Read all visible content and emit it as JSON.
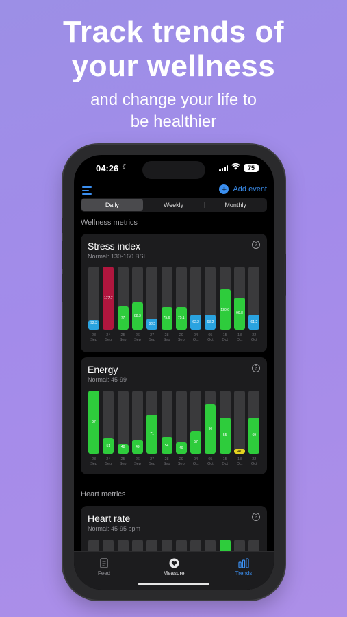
{
  "promo": {
    "headline_line1": "Track trends of",
    "headline_line2": "your wellness",
    "subline_line1": "and change your life to",
    "subline_line2": "be healthier"
  },
  "status_bar": {
    "time": "04:26",
    "battery": "75"
  },
  "topbar": {
    "menu_icon": "menu-icon",
    "add_event_label": "Add event"
  },
  "tabs_period": [
    "Daily",
    "Weekly",
    "Monthly"
  ],
  "selected_period": "Daily",
  "sections": {
    "wellness": "Wellness metrics",
    "heart": "Heart metrics"
  },
  "colors": {
    "green": "#2ecc3c",
    "red": "#b0163e",
    "blue": "#2aa3e0",
    "yellow": "#e5d320",
    "accent": "#3b8ff0"
  },
  "dates": [
    [
      "23",
      "Sep"
    ],
    [
      "24",
      "Sep"
    ],
    [
      "25",
      "Sep"
    ],
    [
      "26",
      "Sep"
    ],
    [
      "27",
      "Sep"
    ],
    [
      "28",
      "Sep"
    ],
    [
      "29",
      "Sep"
    ],
    [
      "04",
      "Oct"
    ],
    [
      "05",
      "Oct"
    ],
    [
      "15",
      "Oct"
    ],
    [
      "18",
      "Oct"
    ],
    [
      "22",
      "Oct"
    ]
  ],
  "stress": {
    "title": "Stress index",
    "normal": "Normal: 130-160 BSI",
    "ylim": [
      0,
      200
    ],
    "bars": [
      {
        "value": 30,
        "label": "92.3",
        "status": "blue"
      },
      {
        "value": 200,
        "label": "177.7",
        "status": "red"
      },
      {
        "value": 75,
        "label": "77",
        "status": "green"
      },
      {
        "value": 88,
        "label": "88.3",
        "status": "green"
      },
      {
        "value": 35,
        "label": "92.2",
        "status": "blue"
      },
      {
        "value": 72,
        "label": "75.6",
        "status": "green"
      },
      {
        "value": 72,
        "label": "75.1",
        "status": "green"
      },
      {
        "value": 48,
        "label": "62.2",
        "status": "blue"
      },
      {
        "value": 48,
        "label": "63.2",
        "status": "blue"
      },
      {
        "value": 128,
        "label": "120.6",
        "status": "green"
      },
      {
        "value": 103,
        "label": "99.8",
        "status": "green"
      },
      {
        "value": 48,
        "label": "61.2",
        "status": "blue"
      }
    ]
  },
  "energy": {
    "title": "Energy",
    "normal": "Normal: 45-99",
    "ylim": [
      0,
      100
    ],
    "bars": [
      {
        "value": 100,
        "label": "97",
        "status": "green"
      },
      {
        "value": 25,
        "label": "51",
        "status": "green"
      },
      {
        "value": 15,
        "label": "48",
        "status": "green"
      },
      {
        "value": 22,
        "label": "49",
        "status": "green"
      },
      {
        "value": 62,
        "label": "71",
        "status": "green"
      },
      {
        "value": 26,
        "label": "54",
        "status": "green"
      },
      {
        "value": 18,
        "label": "49",
        "status": "green"
      },
      {
        "value": 36,
        "label": "57",
        "status": "green"
      },
      {
        "value": 78,
        "label": "90",
        "status": "green"
      },
      {
        "value": 58,
        "label": "55",
        "status": "green"
      },
      {
        "value": 8,
        "label": "47",
        "status": "yellow"
      },
      {
        "value": 58,
        "label": "69",
        "status": "green"
      }
    ]
  },
  "heart_rate": {
    "title": "Heart rate",
    "normal": "Normal: 45-95 bpm"
  },
  "tabbar": {
    "feed": "Feed",
    "measure": "Measure",
    "trends": "Trends"
  }
}
